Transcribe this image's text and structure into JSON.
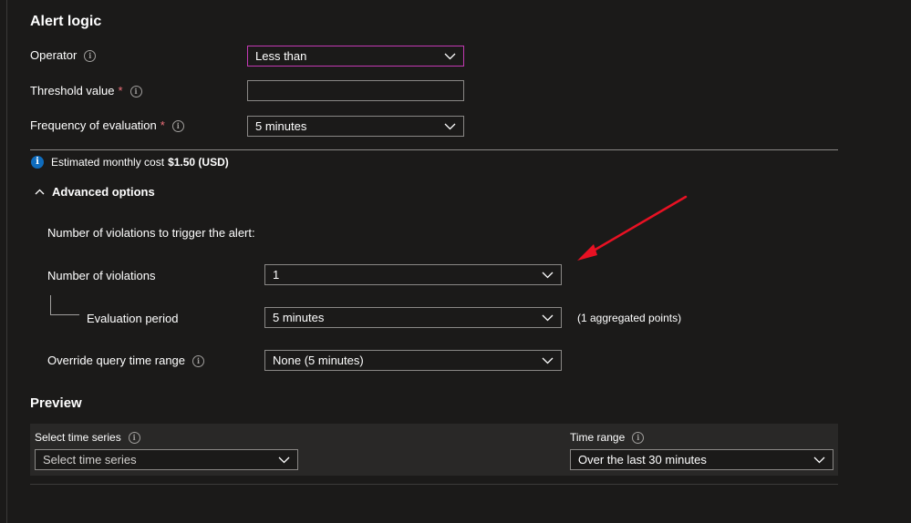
{
  "alert_logic": {
    "title": "Alert logic",
    "operator": {
      "label": "Operator",
      "value": "Less than"
    },
    "threshold": {
      "label": "Threshold value",
      "required_mark": "*",
      "value": ""
    },
    "frequency": {
      "label": "Frequency of evaluation",
      "required_mark": "*",
      "value": "5 minutes"
    }
  },
  "cost": {
    "prefix": "Estimated monthly cost",
    "amount": "$1.50 (USD)"
  },
  "advanced": {
    "toggle_label": "Advanced options",
    "violations_header": "Number of violations to trigger the alert:",
    "num_violations": {
      "label": "Number of violations",
      "value": "1"
    },
    "eval_period": {
      "label": "Evaluation period",
      "value": "5 minutes",
      "note": "(1 aggregated points)"
    },
    "override": {
      "label": "Override query time range",
      "value": "None (5 minutes)"
    }
  },
  "preview": {
    "title": "Preview",
    "time_series": {
      "label": "Select time series",
      "value": "Select time series"
    },
    "time_range": {
      "label": "Time range",
      "value": "Over the last 30 minutes"
    }
  },
  "colors": {
    "accent_focus": "#c239b3",
    "required": "#f1707b",
    "info_blue": "#0f6cbd",
    "annotation_arrow": "#e81123"
  }
}
